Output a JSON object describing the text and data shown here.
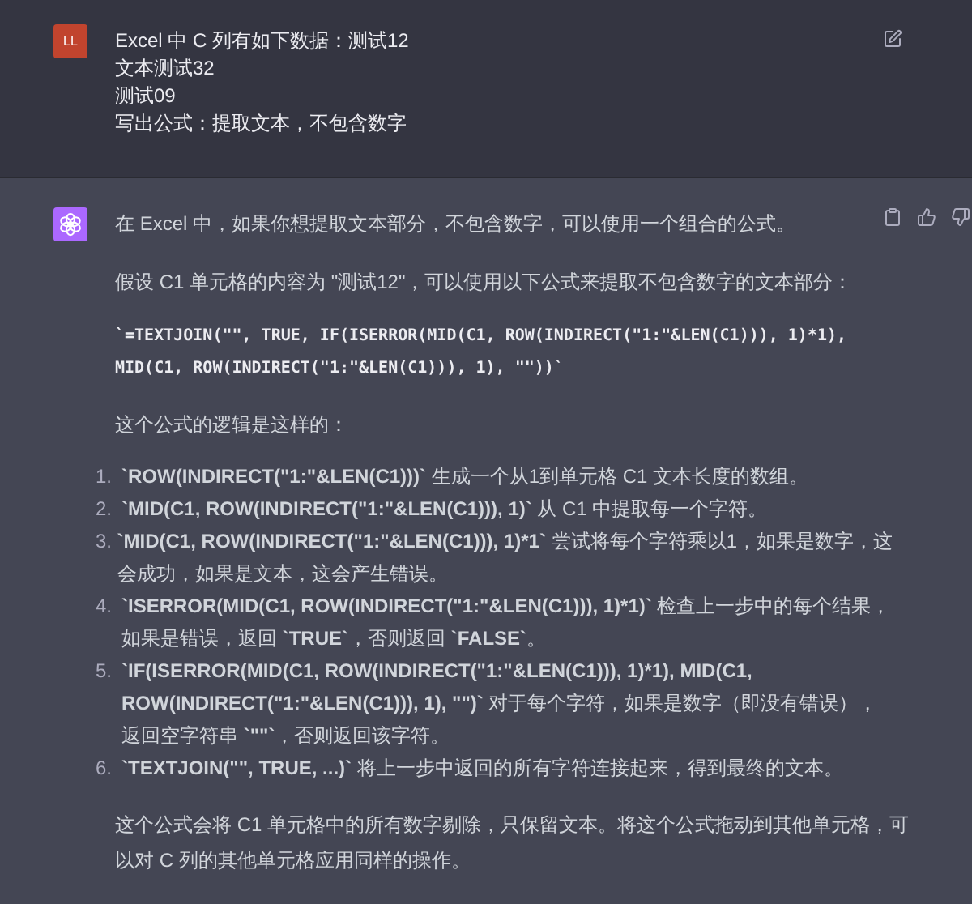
{
  "user_message": {
    "avatar": "LL",
    "lines": [
      "Excel 中 C 列有如下数据：测试12",
      "文本测试32",
      "测试09",
      "写出公式：提取文本，不包含数字"
    ]
  },
  "assistant_message": {
    "intro": "在 Excel 中，如果你想提取文本部分，不包含数字，可以使用一个组合的公式。",
    "assumption": "假设 C1 单元格的内容为 \"测试12\"，可以使用以下公式来提取不包含数字的文本部分：",
    "formula_lines": [
      "`=TEXTJOIN(\"\", TRUE, IF(ISERROR(MID(C1, ROW(INDIRECT(\"1:\"&LEN(C1))), 1)*1),",
      "MID(C1, ROW(INDIRECT(\"1:\"&LEN(C1))), 1), \"\"))`"
    ],
    "logic_heading": "这个公式的逻辑是这样的：",
    "steps": [
      {
        "number": "1.",
        "lines": [
          "**`ROW(INDIRECT(\"1:\"&LEN(C1)))`** 生成一个从1到单元格 C1 文本长度的数组。"
        ]
      },
      {
        "number": "2.",
        "lines": [
          "**`MID(C1, ROW(INDIRECT(\"1:\"&LEN(C1))), 1)`** 从 C1 中提取每一个字符。"
        ]
      },
      {
        "number": "3.",
        "lines": [
          "**`MID(C1, ROW(INDIRECT(\"1:\"&LEN(C1))), 1)*1`** 尝试将每个字符乘以1，如果是数字，这",
          "会成功，如果是文本，这会产生错误。"
        ]
      },
      {
        "number": "4.",
        "lines": [
          "**`ISERROR(MID(C1, ROW(INDIRECT(\"1:\"&LEN(C1))), 1)*1)`** 检查上一步中的每个结果，",
          "如果是错误，返回 **`TRUE`**，否则返回 **`FALSE`**。"
        ]
      },
      {
        "number": "5.",
        "lines": [
          "**`IF(ISERROR(MID(C1, ROW(INDIRECT(\"1:\"&LEN(C1))), 1)*1), MID(C1,**",
          "**ROW(INDIRECT(\"1:\"&LEN(C1))), 1), \"\")`** 对于每个字符，如果是数字（即没有错误），",
          "返回空字符串 **`\"\"`**，否则返回该字符。"
        ]
      },
      {
        "number": "6.",
        "lines": [
          "**`TEXTJOIN(\"\", TRUE, ...)`** 将上一步中返回的所有字符连接起来，得到最终的文本。"
        ]
      }
    ],
    "conclusion_lines": [
      "这个公式会将 C1 单元格中的所有数字剔除，只保留文本。将这个公式拖动到其他单元格，可",
      "以对 C 列的其他单元格应用同样的操作。"
    ]
  }
}
